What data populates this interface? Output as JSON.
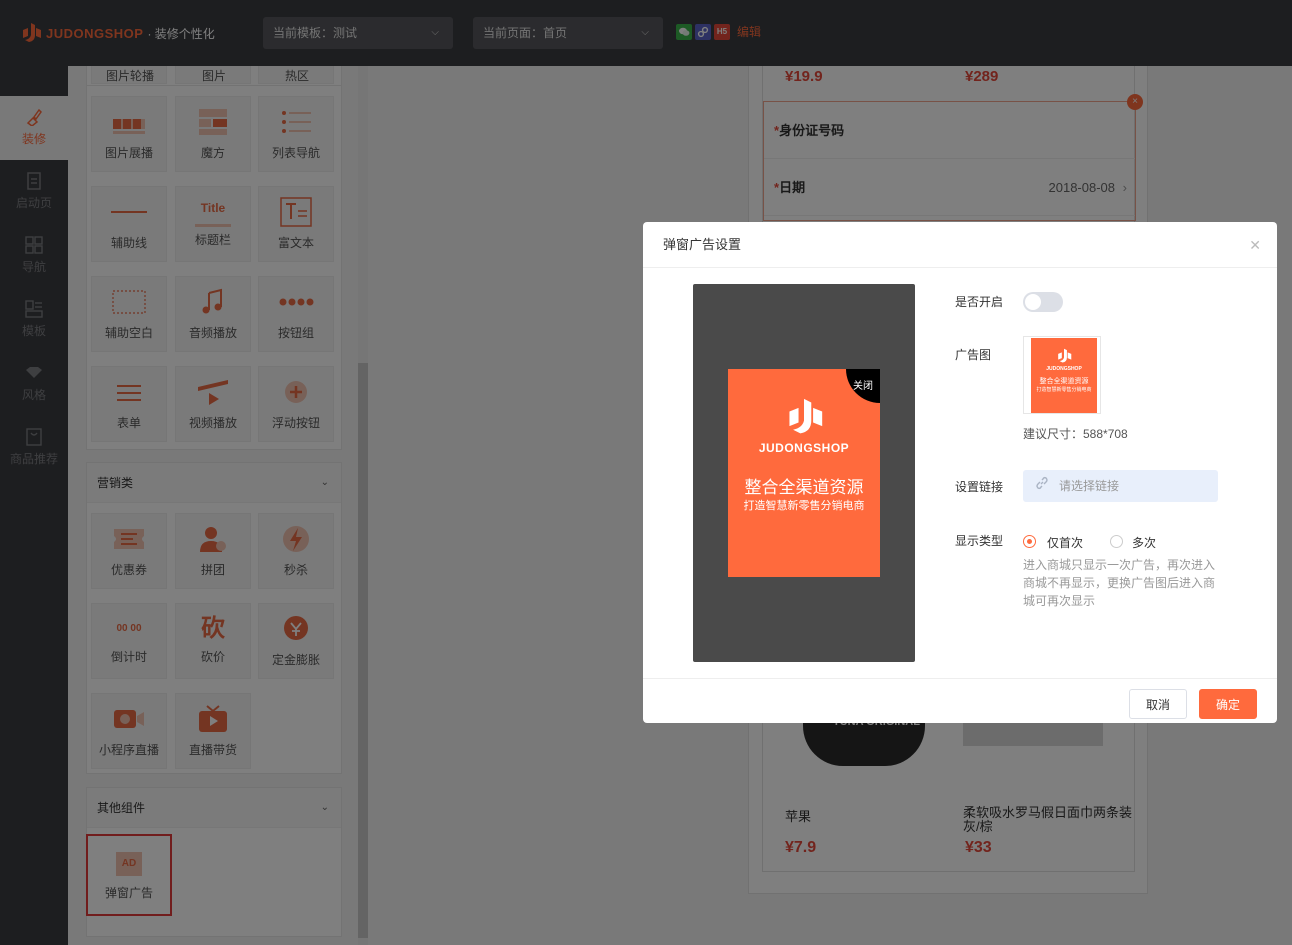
{
  "header": {
    "logo_text": "JUDONGSHOP",
    "logo_sub": "· 装修个性化",
    "template_select": "当前模板：测试",
    "page_select": "当前页面：首页",
    "edit_label": "编辑",
    "icon_names": [
      "wechat-icon",
      "miniprogram-icon",
      "h5-icon"
    ],
    "h5_badge": "H5"
  },
  "sidebar": {
    "items": [
      {
        "label": "装修",
        "icon": "brush-icon",
        "active": true
      },
      {
        "label": "启动页",
        "icon": "document-icon"
      },
      {
        "label": "导航",
        "icon": "grid-icon"
      },
      {
        "label": "模板",
        "icon": "template-icon"
      },
      {
        "label": "风格",
        "icon": "style-icon"
      },
      {
        "label": "商品推荐",
        "icon": "product-icon"
      }
    ]
  },
  "panel": {
    "top_row": [
      "图片轮播",
      "图片",
      "热区"
    ],
    "basic_tiles": [
      {
        "label": "图片展播",
        "icon": "image-showcase-icon"
      },
      {
        "label": "魔方",
        "icon": "cube-icon"
      },
      {
        "label": "列表导航",
        "icon": "list-nav-icon"
      },
      {
        "label": "辅助线",
        "icon": "divider-icon"
      },
      {
        "label": "标题栏",
        "icon": "title-icon",
        "glyph": "Title"
      },
      {
        "label": "富文本",
        "icon": "richtext-icon"
      },
      {
        "label": "辅助空白",
        "icon": "blank-icon"
      },
      {
        "label": "音频播放",
        "icon": "music-icon"
      },
      {
        "label": "按钮组",
        "icon": "button-group-icon"
      },
      {
        "label": "表单",
        "icon": "form-icon"
      },
      {
        "label": "视频播放",
        "icon": "video-icon"
      },
      {
        "label": "浮动按钮",
        "icon": "float-button-icon"
      }
    ],
    "marketing": {
      "title": "营销类",
      "tiles": [
        {
          "label": "优惠券",
          "icon": "coupon-icon"
        },
        {
          "label": "拼团",
          "icon": "group-buy-icon"
        },
        {
          "label": "秒杀",
          "icon": "flash-sale-icon"
        },
        {
          "label": "倒计时",
          "icon": "countdown-icon",
          "glyph": "00 00"
        },
        {
          "label": "砍价",
          "icon": "bargain-icon",
          "glyph": "砍"
        },
        {
          "label": "定金膨胀",
          "icon": "deposit-icon"
        },
        {
          "label": "小程序直播",
          "icon": "live-icon"
        },
        {
          "label": "直播带货",
          "icon": "tv-icon"
        }
      ]
    },
    "others": {
      "title": "其他组件",
      "tiles": [
        {
          "label": "弹窗广告",
          "icon": "ad-icon",
          "glyph": "AD"
        }
      ]
    }
  },
  "preview": {
    "prices_top": [
      "¥19.9",
      "¥289"
    ],
    "form": {
      "id_label": "身份证号码",
      "date_label": "日期",
      "date_value": "2018-08-08",
      "required_mark": "*"
    },
    "products": [
      {
        "name": "苹果",
        "price": "¥7.9"
      },
      {
        "name": "柔软吸水罗马假日面巾两条装 灰/棕",
        "price": "¥33"
      }
    ],
    "can_label": "TUNA ORIGINAL"
  },
  "modal": {
    "title": "弹窗广告设置",
    "ad_card": {
      "close_label": "关闭",
      "brand": "JUDONGSHOP",
      "title": "整合全渠道资源",
      "subtitle": "打造智慧新零售分销电商"
    },
    "enable_label": "是否开启",
    "enabled": false,
    "image_label": "广告图",
    "size_hint": "建议尺寸：588*708",
    "link_label": "设置链接",
    "link_placeholder": "请选择链接",
    "display_label": "显示类型",
    "options": [
      {
        "label": "仅首次",
        "selected": true
      },
      {
        "label": "多次",
        "selected": false
      }
    ],
    "hint": "进入商城只显示一次广告，再次进入商城不再显示，更换广告图后进入商城可再次显示",
    "cancel": "取消",
    "ok": "确定",
    "accent": "#ff6a3d"
  }
}
